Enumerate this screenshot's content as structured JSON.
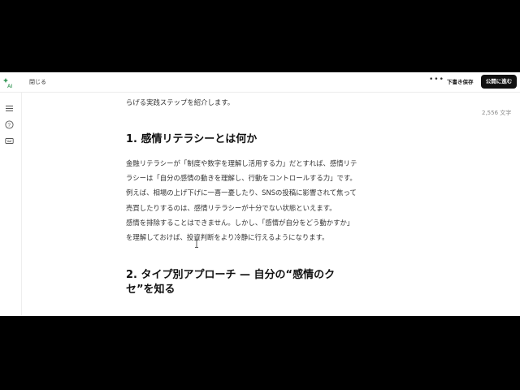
{
  "topbar": {
    "close_label": "閉じる",
    "more_label": "•••",
    "draft_label": "下書き保存",
    "publish_label": "公開に進む"
  },
  "editor": {
    "word_count": "2,556 文字",
    "intro_tail": "らげる実践ステップを紹介します。",
    "section1": {
      "heading": "1. 感情リテラシーとは何か",
      "lines": [
        "金融リテラシーが「制度や数字を理解し活用する力」だとすれば、感情リテ",
        "ラシーは「自分の感情の動きを理解し、行動をコントロールする力」です。",
        "例えば、相場の上げ下げに一喜一憂したり、SNSの投稿に影響されて焦って",
        "売買したりするのは、感情リテラシーが十分でない状態といえます。",
        "感情を排除することはできません。しかし、「感情が自分をどう動かすか」",
        "を理解しておけば、投資判断をより冷静に行えるようになります。"
      ]
    },
    "section2": {
      "heading_line1": "2. タイプ別アプローチ — 自分の“感情のク",
      "heading_line2": "セ”を知る"
    }
  },
  "colors": {
    "accent": "#3a9a5b",
    "publish_bg": "#111111"
  }
}
